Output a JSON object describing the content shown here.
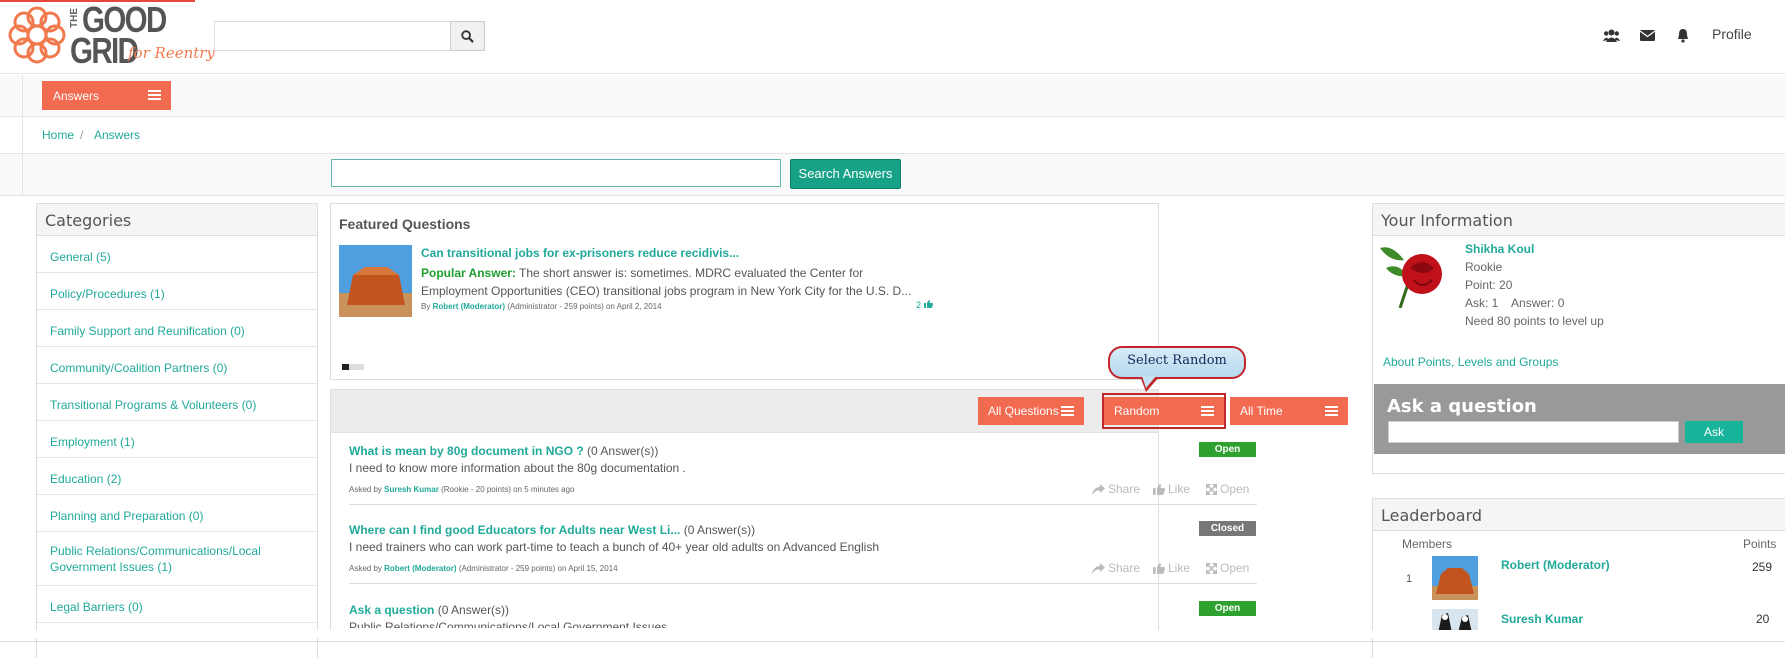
{
  "brand": {
    "logo_the": "THE",
    "logo_good": "GOOD",
    "logo_grid": "GRID",
    "logo_tagline": "for Reentry",
    "accent": "#f26a4f",
    "teal": "#21a99a"
  },
  "header": {
    "search_placeholder": "",
    "search_icon": "search-icon",
    "icons": [
      "users-icon",
      "envelope-icon",
      "bell-icon"
    ],
    "profile_label": "Profile"
  },
  "section_tab": {
    "label": "Answers"
  },
  "breadcrumb": {
    "home": "Home",
    "sep": "/",
    "current": "Answers"
  },
  "answer_search": {
    "value": "",
    "button_label": "Search Answers"
  },
  "categories": {
    "title": "Categories",
    "items": [
      "General (5)",
      "Policy/Procedures (1)",
      "Family Support and Reunification (0)",
      "Community/Coalition Partners (0)",
      "Transitional Programs & Volunteers (0)",
      "Employment (1)",
      "Education (2)",
      "Planning and Preparation (0)",
      "Public Relations/Communications/Local Government Issues (1)",
      "Legal Barriers (0)"
    ]
  },
  "featured": {
    "title": "Featured Questions",
    "question": "Can transitional jobs for ex-prisoners reduce recidivis...",
    "popular_label": "Popular Answer:",
    "popular_text": "The short answer is: sometimes. MDRC evaluated the Center for Employment Opportunities (CEO) transitional jobs program in New York City for the U.S. D...",
    "by_label": "By",
    "author": "Robert (Moderator)",
    "author_meta": "(Administrator - 259 points)  on April 2, 2014",
    "likes": "2"
  },
  "filters": {
    "all_questions": "All Questions",
    "random": "Random",
    "all_time": "All Time"
  },
  "callout": {
    "text": "Select Random"
  },
  "questions": [
    {
      "title": "What is mean by 80g document in NGO ?",
      "answers": "(0 Answer(s))",
      "body": "I need to know more information about the 80g documentation .",
      "asked_by": "Asked by",
      "author": "Suresh Kumar",
      "meta": "(Rookie - 20 points)  on 5 minutes ago",
      "status": "Open"
    },
    {
      "title": "Where can I find good Educators for Adults near West Li...",
      "answers": "(0 Answer(s))",
      "body": "I need trainers who can work part-time to teach a bunch of 40+ year old adults on Advanced English",
      "asked_by": "Asked by",
      "author": "Robert (Moderator)",
      "meta": "(Administrator - 259 points)  on April 15, 2014",
      "status": "Closed"
    },
    {
      "title": "Ask a question",
      "answers": "(0 Answer(s))",
      "body": "Public Relations/Communications/Local Government Issues",
      "status": "Open"
    }
  ],
  "actions": {
    "share": "Share",
    "like": "Like",
    "open": "Open"
  },
  "your_info": {
    "title": "Your Information",
    "name": "Shikha Koul",
    "rank": "Rookie",
    "points": "Point: 20",
    "ask_answer": "Ask: 1    Answer: 0",
    "level_up": "Need 80 points to level up",
    "about_link": "About Points, Levels and Groups"
  },
  "ask": {
    "title": "Ask a question",
    "button": "Ask",
    "value": ""
  },
  "leaderboard": {
    "title": "Leaderboard",
    "col_members": "Members",
    "col_points": "Points",
    "rows": [
      {
        "rank": "1",
        "name": "Robert (Moderator)",
        "points": "259"
      },
      {
        "rank": "",
        "name": "Suresh Kumar",
        "points": "20"
      }
    ]
  }
}
